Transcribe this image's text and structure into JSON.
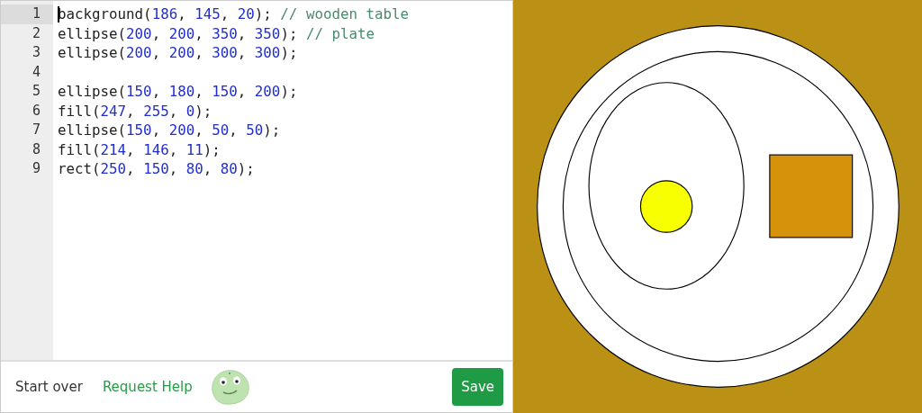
{
  "editor": {
    "lines": [
      {
        "number": "1",
        "active": true,
        "tokens": [
          {
            "kind": "plain",
            "text": "background("
          },
          {
            "kind": "number",
            "text": "186"
          },
          {
            "kind": "plain",
            "text": ", "
          },
          {
            "kind": "number",
            "text": "145"
          },
          {
            "kind": "plain",
            "text": ", "
          },
          {
            "kind": "number",
            "text": "20"
          },
          {
            "kind": "plain",
            "text": "); "
          },
          {
            "kind": "comment",
            "text": "// wooden table"
          }
        ]
      },
      {
        "number": "2",
        "active": false,
        "tokens": [
          {
            "kind": "plain",
            "text": "ellipse("
          },
          {
            "kind": "number",
            "text": "200"
          },
          {
            "kind": "plain",
            "text": ", "
          },
          {
            "kind": "number",
            "text": "200"
          },
          {
            "kind": "plain",
            "text": ", "
          },
          {
            "kind": "number",
            "text": "350"
          },
          {
            "kind": "plain",
            "text": ", "
          },
          {
            "kind": "number",
            "text": "350"
          },
          {
            "kind": "plain",
            "text": "); "
          },
          {
            "kind": "comment",
            "text": "// plate"
          }
        ]
      },
      {
        "number": "3",
        "active": false,
        "tokens": [
          {
            "kind": "plain",
            "text": "ellipse("
          },
          {
            "kind": "number",
            "text": "200"
          },
          {
            "kind": "plain",
            "text": ", "
          },
          {
            "kind": "number",
            "text": "200"
          },
          {
            "kind": "plain",
            "text": ", "
          },
          {
            "kind": "number",
            "text": "300"
          },
          {
            "kind": "plain",
            "text": ", "
          },
          {
            "kind": "number",
            "text": "300"
          },
          {
            "kind": "plain",
            "text": ");"
          }
        ]
      },
      {
        "number": "4",
        "active": false
      },
      {
        "number": "5",
        "active": false,
        "tokens": [
          {
            "kind": "plain",
            "text": "ellipse("
          },
          {
            "kind": "number",
            "text": "150"
          },
          {
            "kind": "plain",
            "text": ", "
          },
          {
            "kind": "number",
            "text": "180"
          },
          {
            "kind": "plain",
            "text": ", "
          },
          {
            "kind": "number",
            "text": "150"
          },
          {
            "kind": "plain",
            "text": ", "
          },
          {
            "kind": "number",
            "text": "200"
          },
          {
            "kind": "plain",
            "text": ");"
          }
        ]
      },
      {
        "number": "6",
        "active": false,
        "tokens": [
          {
            "kind": "plain",
            "text": "fill("
          },
          {
            "kind": "number",
            "text": "247"
          },
          {
            "kind": "plain",
            "text": ", "
          },
          {
            "kind": "number",
            "text": "255"
          },
          {
            "kind": "plain",
            "text": ", "
          },
          {
            "kind": "number",
            "text": "0"
          },
          {
            "kind": "plain",
            "text": ");"
          }
        ]
      },
      {
        "number": "7",
        "active": false,
        "tokens": [
          {
            "kind": "plain",
            "text": "ellipse("
          },
          {
            "kind": "number",
            "text": "150"
          },
          {
            "kind": "plain",
            "text": ", "
          },
          {
            "kind": "number",
            "text": "200"
          },
          {
            "kind": "plain",
            "text": ", "
          },
          {
            "kind": "number",
            "text": "50"
          },
          {
            "kind": "plain",
            "text": ", "
          },
          {
            "kind": "number",
            "text": "50"
          },
          {
            "kind": "plain",
            "text": ");"
          }
        ]
      },
      {
        "number": "8",
        "active": false,
        "tokens": [
          {
            "kind": "plain",
            "text": "fill("
          },
          {
            "kind": "number",
            "text": "214"
          },
          {
            "kind": "plain",
            "text": ", "
          },
          {
            "kind": "number",
            "text": "146"
          },
          {
            "kind": "plain",
            "text": ", "
          },
          {
            "kind": "number",
            "text": "11"
          },
          {
            "kind": "plain",
            "text": ");"
          }
        ]
      },
      {
        "number": "9",
        "active": false,
        "tokens": [
          {
            "kind": "plain",
            "text": "rect("
          },
          {
            "kind": "number",
            "text": "250"
          },
          {
            "kind": "plain",
            "text": ", "
          },
          {
            "kind": "number",
            "text": "150"
          },
          {
            "kind": "plain",
            "text": ", "
          },
          {
            "kind": "number",
            "text": "80"
          },
          {
            "kind": "plain",
            "text": ", "
          },
          {
            "kind": "number",
            "text": "80"
          },
          {
            "kind": "plain",
            "text": ");"
          }
        ]
      }
    ]
  },
  "footer": {
    "start_over": "Start over",
    "request_help": "Request Help",
    "save": "Save"
  }
}
